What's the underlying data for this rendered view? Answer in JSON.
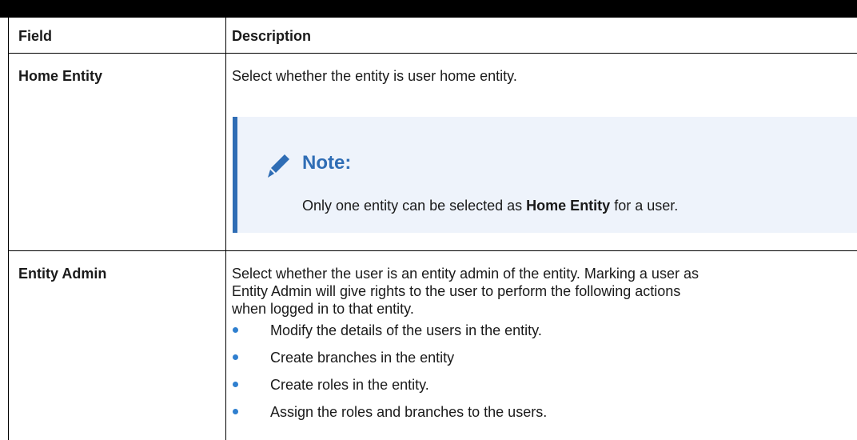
{
  "table": {
    "headers": {
      "field": "Field",
      "description": "Description"
    },
    "rows": [
      {
        "field": "Home Entity",
        "description": "Select whether the entity is user home entity.",
        "note": {
          "title": "Note:",
          "icon": "pencil-icon",
          "text_before": "Only one entity can be selected as ",
          "text_bold": "Home Entity",
          "text_after": " for a user."
        }
      },
      {
        "field": "Entity Admin",
        "description_lines": [
          "Select whether the user is an entity admin of the entity. Marking a user as",
          "Entity Admin will give rights to the user to perform the following actions",
          "when logged in to that entity."
        ],
        "bullets": [
          "Modify the details of the users in the entity.",
          "Create branches in the entity",
          "Create roles in the entity.",
          "Assign the roles and branches to the users."
        ]
      }
    ]
  },
  "colors": {
    "accent": "#2f6db5",
    "note_background": "#eef3fb",
    "bullet": "#2f7fcf"
  }
}
